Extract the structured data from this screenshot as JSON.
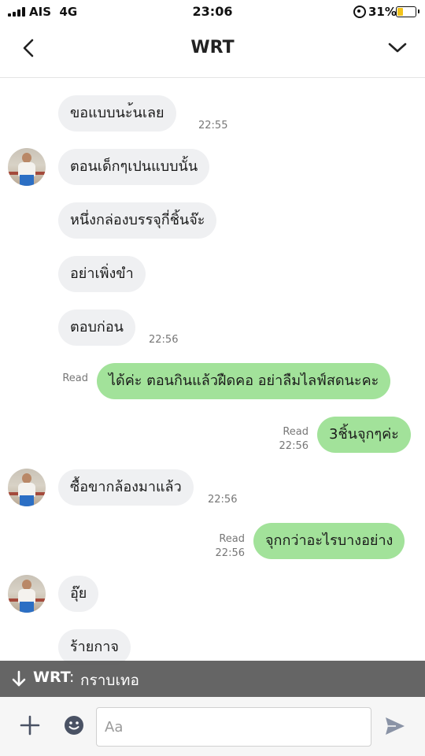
{
  "status_bar": {
    "carrier": "AIS",
    "network": "4G",
    "time": "23:06",
    "battery_percent": "31%",
    "battery_level": 0.31,
    "battery_color": "#f2c31b"
  },
  "header": {
    "title": "WRT",
    "back_icon": "chevron-left-icon",
    "menu_icon": "chevron-down-icon"
  },
  "messages": [
    {
      "side": "in",
      "text": "ขอแบบนะ้นเลย",
      "time": "22:55"
    },
    {
      "side": "in",
      "text": "ตอนเด็กๆเปนแบบนั้น",
      "avatar": true
    },
    {
      "side": "in",
      "text": "หนึ่งกล่องบรรจุกี่ชิ้นจ๊ะ"
    },
    {
      "side": "in",
      "text": "อย่าเพิ่งขำ"
    },
    {
      "side": "in",
      "text": "ตอบก่อน",
      "time": "22:56"
    },
    {
      "side": "out",
      "text": "ได้ค่ะ ตอนกินแล้วฝืดคอ อย่าลืมไลฟ์สดนะคะ",
      "read": "Read"
    },
    {
      "side": "out",
      "text": "3ชิ้นจุกๆค่ะ",
      "read": "Read",
      "time": "22:56"
    },
    {
      "side": "in",
      "text": "ซื้อขากล้องมาแล้ว",
      "time": "22:56",
      "avatar": true
    },
    {
      "side": "out",
      "text": "จุกกว่าอะไรบางอย่าง",
      "read": "Read",
      "time": "22:56"
    },
    {
      "side": "in",
      "text": "อุ๊ย",
      "avatar": true
    },
    {
      "side": "in",
      "text": "ร้ายกาจ"
    }
  ],
  "banner": {
    "sender": "WRT",
    "separator": ":",
    "text": "กราบเทอ"
  },
  "input_bar": {
    "placeholder": "Aa"
  },
  "colors": {
    "incoming_bubble": "#eff0f2",
    "outgoing_bubble": "#a2e29a",
    "send_icon": "#8a93a6"
  }
}
